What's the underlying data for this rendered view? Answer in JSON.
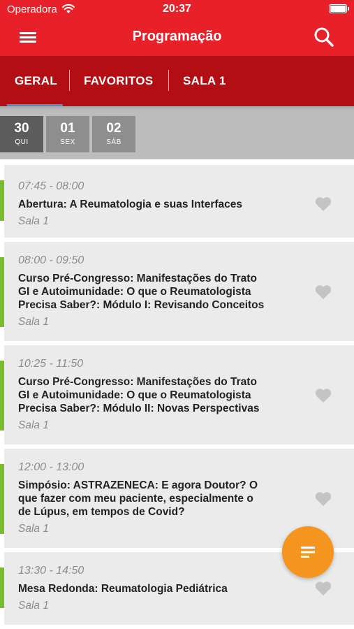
{
  "status_bar": {
    "carrier": "Operadora",
    "time": "20:37",
    "wifi_icon": "wifi-icon",
    "battery_icon": "battery-icon"
  },
  "nav": {
    "title": "Programação",
    "menu_icon": "hamburger-menu-icon",
    "search_icon": "search-icon"
  },
  "tabs": [
    {
      "label": "GERAL",
      "selected": true
    },
    {
      "label": "FAVORITOS",
      "selected": false
    },
    {
      "label": "SALA 1",
      "selected": false
    }
  ],
  "dates": [
    {
      "day": "30",
      "weekday": "QUI",
      "selected": true
    },
    {
      "day": "01",
      "weekday": "SEX",
      "selected": false
    },
    {
      "day": "02",
      "weekday": "SÁB",
      "selected": false
    }
  ],
  "sessions": [
    {
      "time": "07:45 - 08:00",
      "title_lines": [
        "Abertura: A Reumatologia e suas Interfaces"
      ],
      "room": "Sala 1",
      "favorite": false
    },
    {
      "time": "08:00 - 09:50",
      "title_lines": [
        "Curso Pré-Congresso: Manifestações do Trato",
        "GI e Autoimunidade: O que o Reumatologista",
        "Precisa Saber?: Módulo I: Revisando Conceitos"
      ],
      "room": "Sala 1",
      "favorite": false
    },
    {
      "time": "10:25 - 11:50",
      "title_lines": [
        "Curso Pré-Congresso: Manifestações do Trato",
        "GI e Autoimunidade: O que o Reumatologista",
        "Precisa Saber?: Módulo II: Novas Perspectivas"
      ],
      "room": "Sala 1",
      "favorite": false
    },
    {
      "time": "12:00 - 13:00",
      "title_lines": [
        "Simpósio: ASTRAZENECA: E agora Doutor? O",
        "que fazer com meu paciente, especialmente o",
        "de Lúpus, em tempos de Covid?"
      ],
      "room": "Sala 1",
      "favorite": false
    },
    {
      "time": "13:30 - 14:50",
      "title_lines": [
        "Mesa Redonda: Reumatologia Pediátrica"
      ],
      "room": "Sala 1",
      "favorite": false
    }
  ],
  "fab": {
    "icon": "filter-list-icon"
  },
  "colors": {
    "primary": "#e8202a",
    "tabs_bg": "#b30e14",
    "accent_bar": "#7bbb2e",
    "fab": "#f4951f",
    "tab_indicator": "#4a90c8"
  }
}
